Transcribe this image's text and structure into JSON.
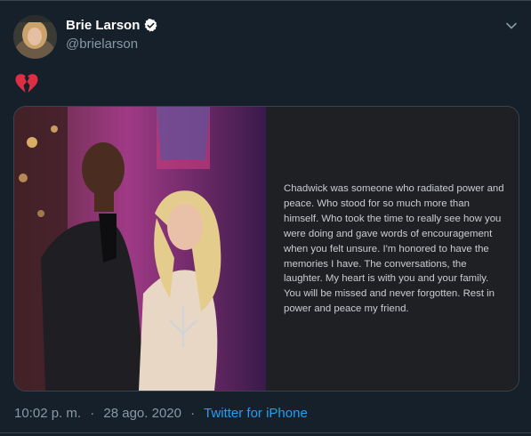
{
  "colors": {
    "background": "#15202b",
    "accent": "#1da1f2",
    "secondary_text": "#8899a6",
    "verified_badge": "#ffffff",
    "broken_heart": "#dd2e44"
  },
  "author": {
    "display_name": "Brie Larson",
    "handle": "@brielarson",
    "verified_icon": "verified-badge-icon"
  },
  "tweet": {
    "emoji": "broken-heart",
    "statement": "Chadwick was someone who radiated power and peace. Who stood for so much more than himself. Who took the time to really see how you were doing and gave words of encouragement when you felt unsure. I'm honored to have the memories I have. The conversations, the laughter. My heart is with you and your family. You will be missed and never forgotten. Rest in power and peace my friend."
  },
  "meta": {
    "time": "10:02 p. m.",
    "separator": "·",
    "date": "28 ago. 2020",
    "source": "Twitter for iPhone"
  },
  "icons": {
    "menu": "chevron-down-icon"
  }
}
